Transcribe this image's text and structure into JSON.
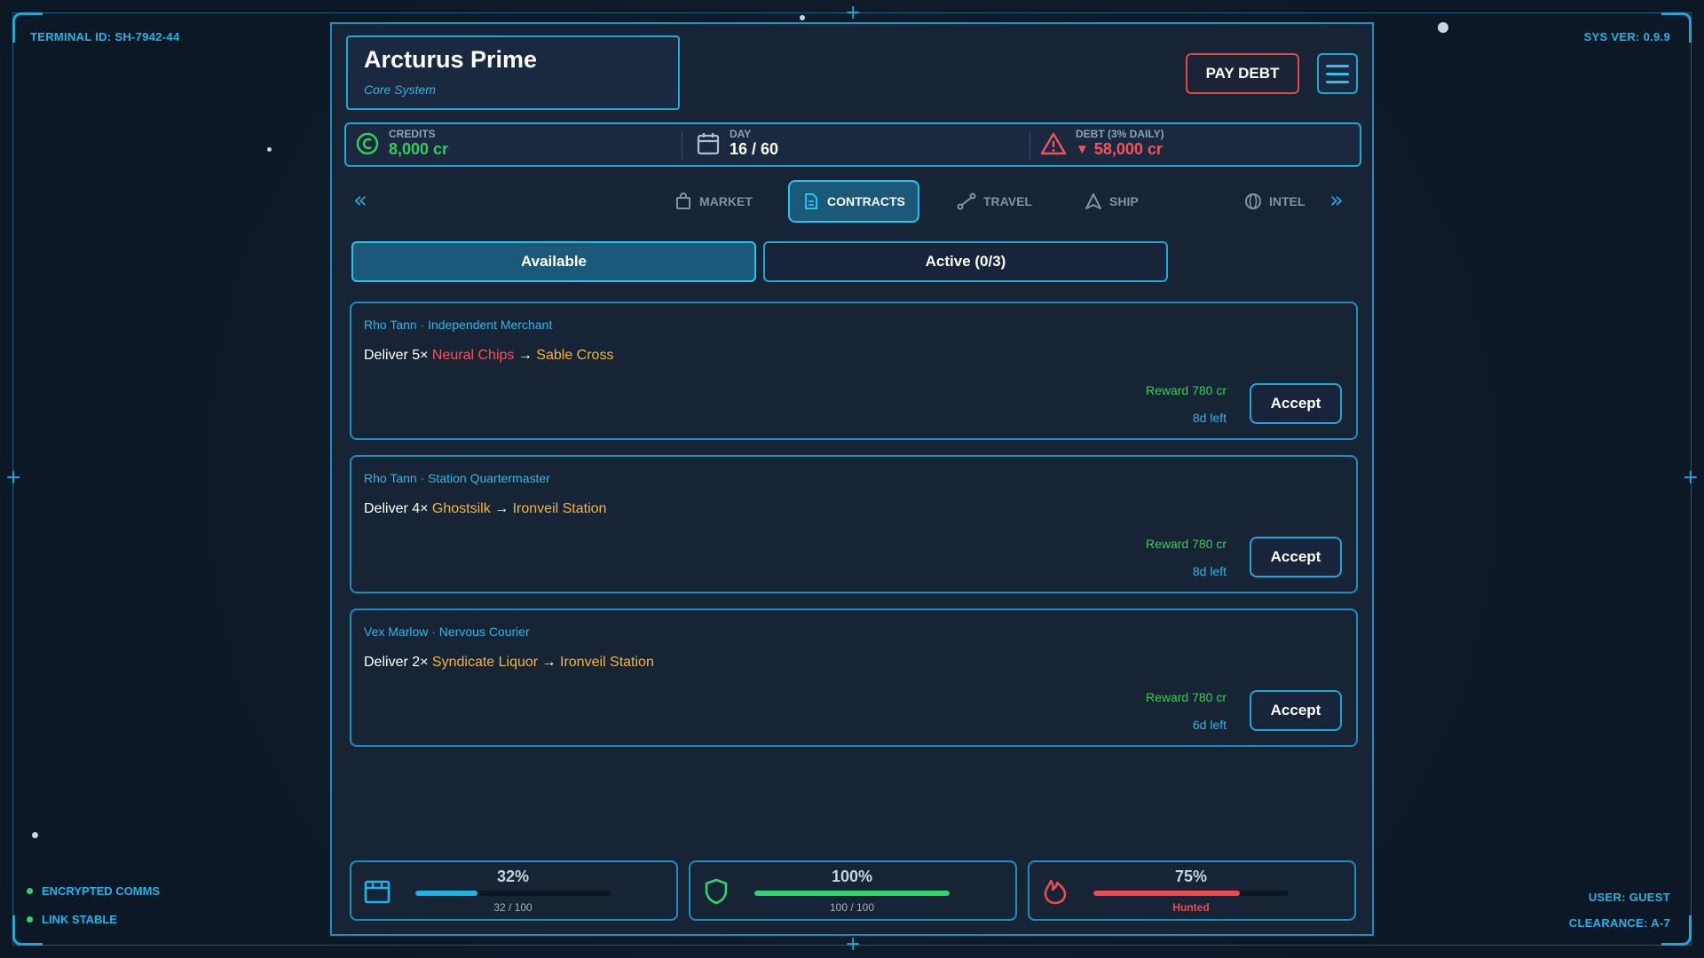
{
  "terminal": {
    "id_label": "TERMINAL ID: SH-7942-44",
    "sys_ver": "SYS VER: 0.9.9",
    "status_1": "ENCRYPTED COMMS",
    "status_2": "LINK STABLE",
    "user": "USER: GUEST",
    "clearance": "CLEARANCE: A-7"
  },
  "location": {
    "name": "Arcturus Prime",
    "type": "Core System"
  },
  "header_actions": {
    "pay_debt": "PAY DEBT",
    "menu_icon": "hamburger-icon"
  },
  "stats": {
    "credits_label": "CREDITS",
    "credits_value": "8,000 cr",
    "day_label": "DAY",
    "day_value": "16 / 60",
    "debt_label": "DEBT (3% DAILY)",
    "debt_value": "58,000 cr"
  },
  "tabs": [
    {
      "label": "MARKET",
      "icon": "bag-icon"
    },
    {
      "label": "CONTRACTS",
      "icon": "document-icon",
      "active": true
    },
    {
      "label": "TRAVEL",
      "icon": "route-icon"
    },
    {
      "label": "SHIP",
      "icon": "ship-icon"
    },
    {
      "label": "INTEL",
      "icon": "globe-icon"
    }
  ],
  "subtabs": {
    "available": "Available",
    "active": "Active (0/3)"
  },
  "contracts": [
    {
      "issuer": "Rho Tann · Independent Merchant",
      "prefix": "Deliver 5× ",
      "good": "Neural Chips",
      "arrow": " → ",
      "dest": "Sable Cross",
      "reward": "Reward 780 cr",
      "time_left": "8d left",
      "accept": "Accept"
    },
    {
      "issuer": "Rho Tann · Station Quartermaster",
      "prefix": "Deliver 4× ",
      "good": "Ghostsilk",
      "arrow": " → ",
      "dest": "Ironveil Station",
      "reward": "Reward 780 cr",
      "time_left": "8d left",
      "accept": "Accept"
    },
    {
      "issuer": "Vex Marlow · Nervous Courier",
      "prefix": "Deliver 2× ",
      "good": "Syndicate Liquor",
      "arrow": " → ",
      "dest": "Ironveil Station",
      "reward": "Reward 780 cr",
      "time_left": "6d left",
      "accept": "Accept"
    }
  ],
  "gauges": [
    {
      "name": "cargo",
      "pct": "32%",
      "fill": 0.32,
      "sub": "32 / 100",
      "color": "#1fb4e6"
    },
    {
      "name": "hull",
      "pct": "100%",
      "fill": 1.0,
      "sub": "100 / 100",
      "color": "#2fd46a"
    },
    {
      "name": "heat",
      "pct": "75%",
      "fill": 0.75,
      "sub": "Hunted",
      "color": "#ef4a4f"
    }
  ],
  "colors": {
    "accent": "#1fa7d6",
    "credits": "#36cc5a",
    "debt": "#f0545a",
    "highlight": "#f2b43a"
  }
}
